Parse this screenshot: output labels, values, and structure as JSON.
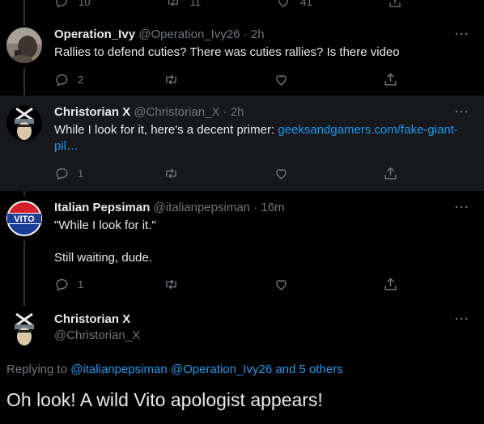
{
  "top_actions": {
    "reply_count": "10",
    "retweet_count": "11",
    "like_count": "41"
  },
  "tweets": [
    {
      "name": "Operation_Ivy",
      "handle": "@Operation_Ivy26",
      "time": "2h",
      "text": "Rallies to defend cuties? There was cuties rallies? Is there video",
      "reply_count": "2",
      "retweet_count": "",
      "like_count": ""
    },
    {
      "name": "Christorian X",
      "handle": "@Christorian_X",
      "time": "2h",
      "text": "While I look for it, here's a decent primer: ",
      "link": "geeksandgamers.com/fake-giant-pil…",
      "reply_count": "1",
      "retweet_count": "",
      "like_count": ""
    },
    {
      "name": "Italian Pepsiman",
      "handle": "@italianpepsiman",
      "time": "16m",
      "text": "\"While I look for it.\"\n\nStill waiting, dude.",
      "reply_count": "1",
      "retweet_count": "",
      "like_count": ""
    }
  ],
  "main_tweet": {
    "name": "Christorian X",
    "handle": "@Christorian_X",
    "replying_prefix": "Replying to ",
    "replying_users": [
      "@italianpepsiman",
      "@Operation_Ivy26"
    ],
    "replying_others": "and 5 others",
    "text": "Oh look! A wild Vito apologist appears!"
  },
  "more_icon": "more-horizontal-icon",
  "vito_logo_text": "VITO",
  "colors": {
    "background": "#000000",
    "highlight": "#16181c",
    "link": "#1d9bf0",
    "muted": "#71767b"
  }
}
